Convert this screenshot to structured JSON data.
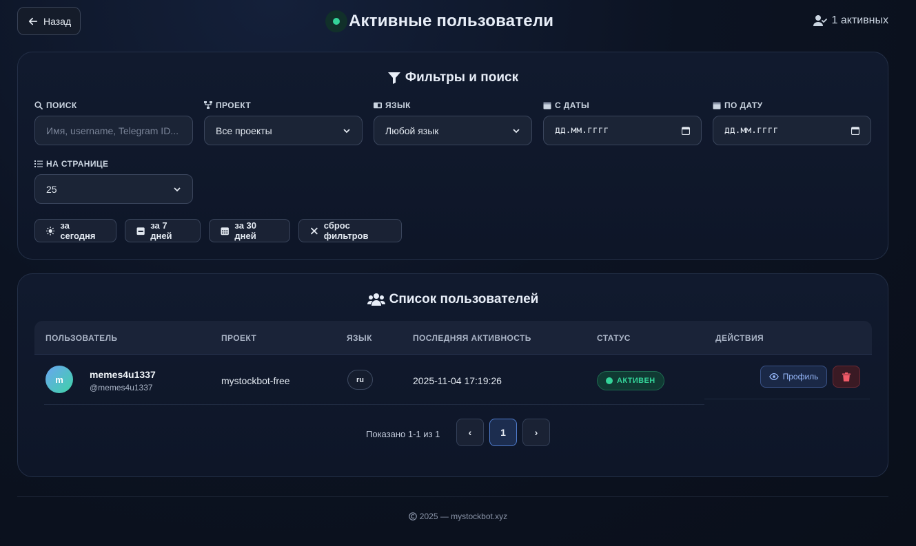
{
  "header": {
    "back_label": "Назад",
    "title": "Активные пользователи",
    "active_count": "1 активных"
  },
  "filters": {
    "title": "Фильтры и поиск",
    "search": {
      "label": "ПОИСК",
      "placeholder": "Имя, username, Telegram ID..."
    },
    "project": {
      "label": "ПРОЕКТ",
      "value": "Все проекты"
    },
    "language": {
      "label": "ЯЗЫК",
      "value": "Любой язык"
    },
    "date_from": {
      "label": "С ДАТЫ",
      "value": "дд.мм.гггг"
    },
    "date_to": {
      "label": "ПО ДАТУ",
      "value": "дд.мм.гггг"
    },
    "per_page": {
      "label": "НА СТРАНИЦЕ",
      "value": "25"
    },
    "quick": {
      "today": "за сегодня",
      "week": "за 7 дней",
      "month": "за 30 дней",
      "reset": "сброс фильтров"
    }
  },
  "users": {
    "title": "Список пользователей",
    "columns": [
      "ПОЛЬЗОВАТЕЛЬ",
      "ПРОЕКТ",
      "ЯЗЫК",
      "ПОСЛЕДНЯЯ АКТИВНОСТЬ",
      "СТАТУС",
      "ДЕЙСТВИЯ"
    ],
    "rows": [
      {
        "avatar": "m",
        "name": "memes4u1337",
        "handle": "@memes4u1337",
        "project": "mystockbot-free",
        "lang": "ru",
        "last_active": "2025-11-04 17:19:26",
        "status": "АКТИВЕН",
        "profile_label": "Профиль"
      }
    ],
    "pager": {
      "info": "Показано 1-1 из 1",
      "prev": "‹",
      "current": "1",
      "next": "›"
    }
  },
  "footer": {
    "text": "2025 — mystockbot.xyz"
  },
  "colors": {
    "accent_green": "#34d399",
    "accent_blue": "#93b4f5",
    "danger": "#f05a68"
  },
  "icons": [
    "arrow-left-icon",
    "user-check-icon",
    "filter-icon",
    "search-icon",
    "sitemap-icon",
    "language-icon",
    "calendar-icon",
    "list-icon",
    "sun-icon",
    "calendar-week-icon",
    "calendar-month-icon",
    "close-icon",
    "users-icon",
    "eye-icon",
    "trash-icon",
    "copyright-icon",
    "chevron-down-icon"
  ]
}
